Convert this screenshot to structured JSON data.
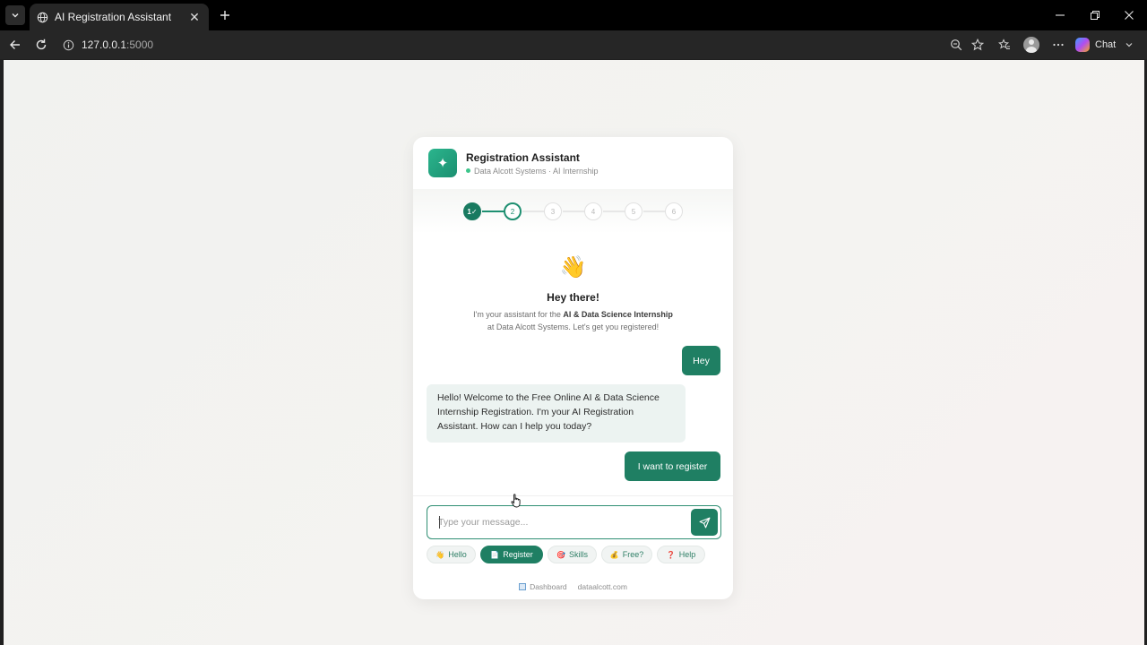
{
  "browser": {
    "tab_title": "AI Registration Assistant",
    "url_host": "127.0.0.1",
    "url_port": ":5000",
    "chat_label": "Chat"
  },
  "assistant": {
    "logo_glyph": "✦",
    "title": "Registration Assistant",
    "subtitle": "Data Alcott Systems · AI Internship",
    "status_color": "#3cc58b"
  },
  "steps": [
    "1✓",
    "2",
    "3",
    "4",
    "5",
    "6"
  ],
  "welcome": {
    "emoji": "👋",
    "title": "Hey there!",
    "line1_prefix": "I'm your assistant for the ",
    "line1_bold": "AI & Data Science Internship",
    "line2": "at Data Alcott Systems. Let's get you registered!"
  },
  "messages": {
    "user_1": "Hey",
    "bot_1": "Hello! Welcome to the Free Online AI & Data Science Internship Registration. I'm your AI Registration Assistant. How can I help you today?",
    "user_2": "I want to register"
  },
  "input": {
    "placeholder": "Type your message..."
  },
  "quick_replies": [
    {
      "emoji": "👋",
      "label": "Hello"
    },
    {
      "emoji": "📄",
      "label": "Register"
    },
    {
      "emoji": "🎯",
      "label": "Skills"
    },
    {
      "emoji": "💰",
      "label": "Free?"
    },
    {
      "emoji": "❓",
      "label": "Help"
    }
  ],
  "footer": {
    "dashboard": "Dashboard",
    "site": "dataalcott.com"
  },
  "colors": {
    "accent": "#1f7f63",
    "bot_bubble": "#ecf3f1"
  }
}
